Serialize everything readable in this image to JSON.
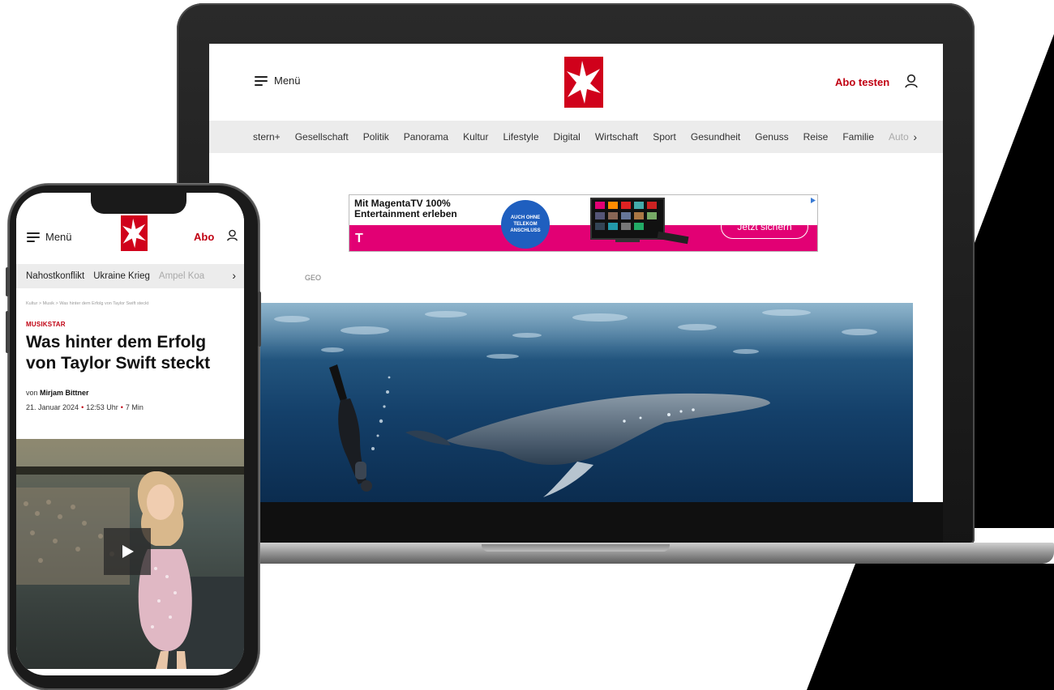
{
  "desktop": {
    "menu_label": "Menü",
    "abo_label": "Abo testen",
    "nav_items": [
      "stern+",
      "Gesellschaft",
      "Politik",
      "Panorama",
      "Kultur",
      "Lifestyle",
      "Digital",
      "Wirtschaft",
      "Sport",
      "Gesundheit",
      "Genuss",
      "Reise",
      "Familie",
      "Auto"
    ],
    "nav_more": "›",
    "ad": {
      "headline_line1": "Mit MagentaTV 100%",
      "headline_line2": "Entertainment erleben",
      "badge_line1": "AUCH OHNE",
      "badge_line2": "TELEKOM",
      "badge_line3": "ANSCHLUSS",
      "cta": "Jetzt sichern",
      "brand_glyph": "T",
      "brand_color": "#e20074"
    },
    "section_label": "GEO"
  },
  "mobile": {
    "menu_label": "Menü",
    "abo_label": "Abo",
    "nav_items": [
      "Nahostkonflikt",
      "Ukraine Krieg",
      "Ampel Koa"
    ],
    "nav_more": "›",
    "breadcrumb": "Kultur  >  Musik  >  Was hinter dem Erfolg von Taylor Swift steckt",
    "kicker": "MUSIKSTAR",
    "title": "Was hinter dem Erfolg von Taylor Swift steckt",
    "author_prefix": "von",
    "author": "Mirjam Bittner",
    "date": "21. Januar 2024",
    "time": "12:53 Uhr",
    "read_time": "7 Min"
  },
  "colors": {
    "brand_red": "#d0011b",
    "accent_red": "#c00012",
    "nav_bg": "#ececec"
  },
  "icons": [
    "hamburger-menu-icon",
    "stern-logo",
    "user-icon",
    "chevron-right-icon",
    "play-icon",
    "adchoices-icon"
  ]
}
